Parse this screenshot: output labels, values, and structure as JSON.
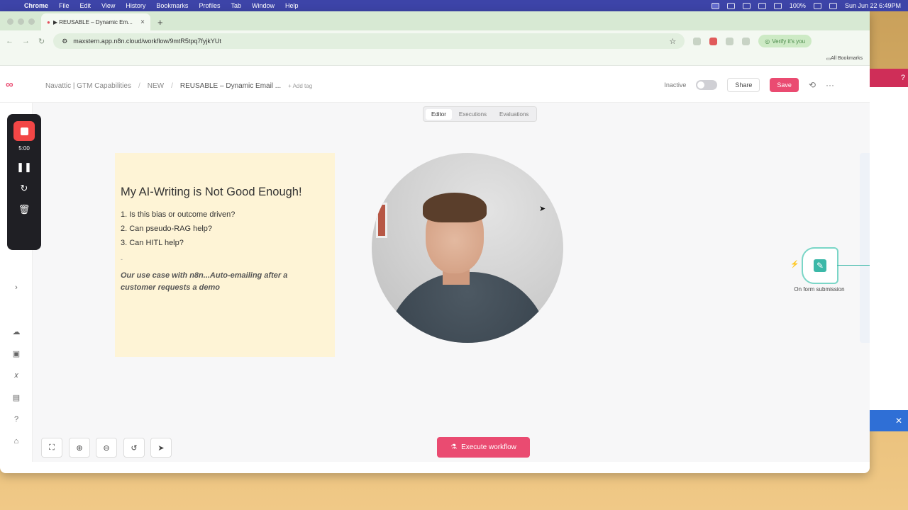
{
  "menubar": {
    "apple": "",
    "items": [
      "Chrome",
      "File",
      "Edit",
      "View",
      "History",
      "Bookmarks",
      "Profiles",
      "Tab",
      "Window",
      "Help"
    ],
    "battery": "100%",
    "clock": "Sun Jun 22  6:49PM"
  },
  "browser": {
    "tab_title": "▶ REUSABLE – Dynamic Em...",
    "tab_close": "×",
    "new_tab": "+",
    "back": "←",
    "forward": "→",
    "reload": "↻",
    "url": "maxstern.app.n8n.cloud/workflow/9mtR5tpq7fyjkYUt",
    "star": "☆",
    "verify_label": "Verify it's you",
    "profile_label": "you",
    "all_bookmarks": "All Bookmarks",
    "bookmarks": "Bookmarks"
  },
  "header": {
    "logo": "∞",
    "breadcrumb": [
      "Navattic | GTM Capabilities",
      "NEW",
      "REUSABLE – Dynamic Email ..."
    ],
    "add_tag": "+ Add tag",
    "status": "Inactive",
    "share": "Share",
    "save": "Save",
    "history_icon": "⟲",
    "more_icon": "···"
  },
  "view_tabs": [
    "Editor",
    "Executions",
    "Evaluations"
  ],
  "recorder": {
    "time": "5:00",
    "pause": "❚❚",
    "restart": "↻",
    "delete": "🗑"
  },
  "sticky": {
    "title": "My AI-Writing is Not Good Enough!",
    "items": [
      "1. Is this bias or outcome driven?",
      "2. Can pseudo-RAG help?",
      "3. Can HITL help?"
    ],
    "dash": "-",
    "use_case": "Our use case with n8n...Auto-emailing after a customer requests a demo"
  },
  "node": {
    "label": "On form submission",
    "bolt": "⚡",
    "icon": "✎"
  },
  "controls": {
    "fit": "⛶",
    "zoom_in": "⊕",
    "zoom_out": "⊖",
    "reset": "↺",
    "select": "➤",
    "execute_icon": "⚗",
    "execute": "Execute workflow"
  },
  "sidebar_icons": {
    "cloud": "☁",
    "box": "▣",
    "variables": "𝑥",
    "insights": "▤",
    "help": "?",
    "gift": "⌂",
    "expand": "›"
  },
  "right_window": {
    "help": "?",
    "close": "✕"
  }
}
